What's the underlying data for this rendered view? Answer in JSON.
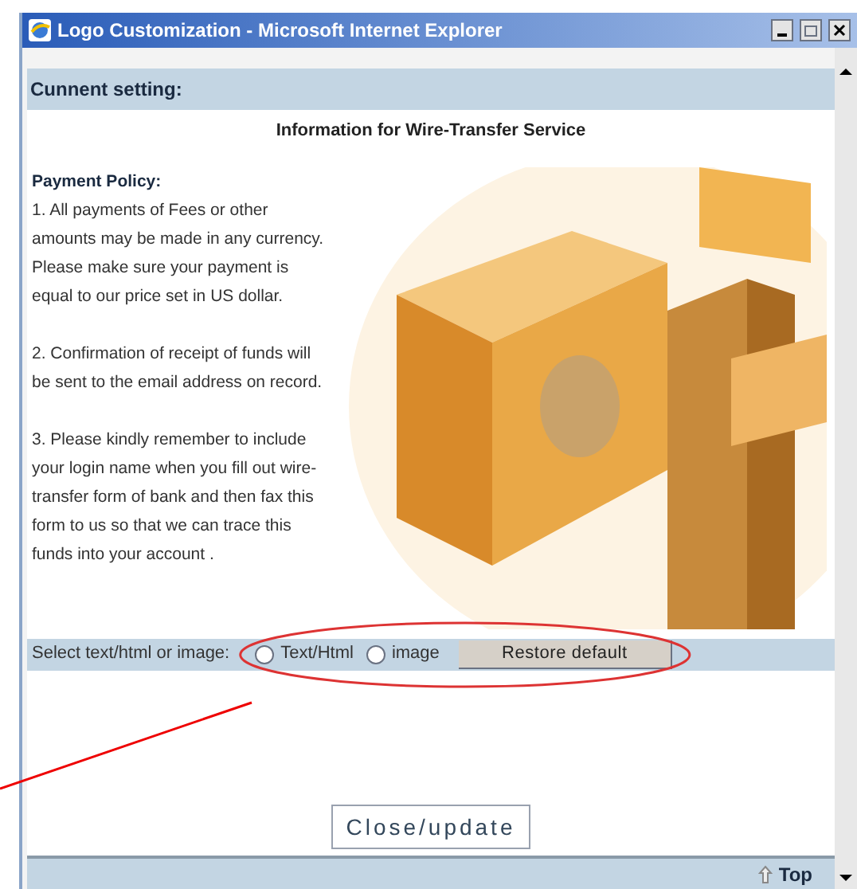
{
  "window": {
    "title": "Logo Customization - Microsoft Internet Explorer"
  },
  "header": {
    "label": "Cunnent setting:"
  },
  "heading": "Information for Wire-Transfer Service",
  "policy": {
    "title": "Payment Policy:",
    "paragraphs": [
      "1. All payments of Fees or other amounts may be made in any currency. Please make sure your payment is equal to our price set in US dollar.",
      "2. Confirmation of receipt of funds will be sent to the email address on record.",
      "3. Please kindly remember to include your login name when you fill out wire-transfer form of bank and then fax this form to us so that we can trace this funds into your account ."
    ]
  },
  "select_row": {
    "label": "Select text/html or image:",
    "options": [
      {
        "label": "Text/Html",
        "selected": false
      },
      {
        "label": "image",
        "selected": false
      }
    ],
    "button": "Restore default"
  },
  "close_button": "Close/update",
  "footer": {
    "link": "Top"
  }
}
